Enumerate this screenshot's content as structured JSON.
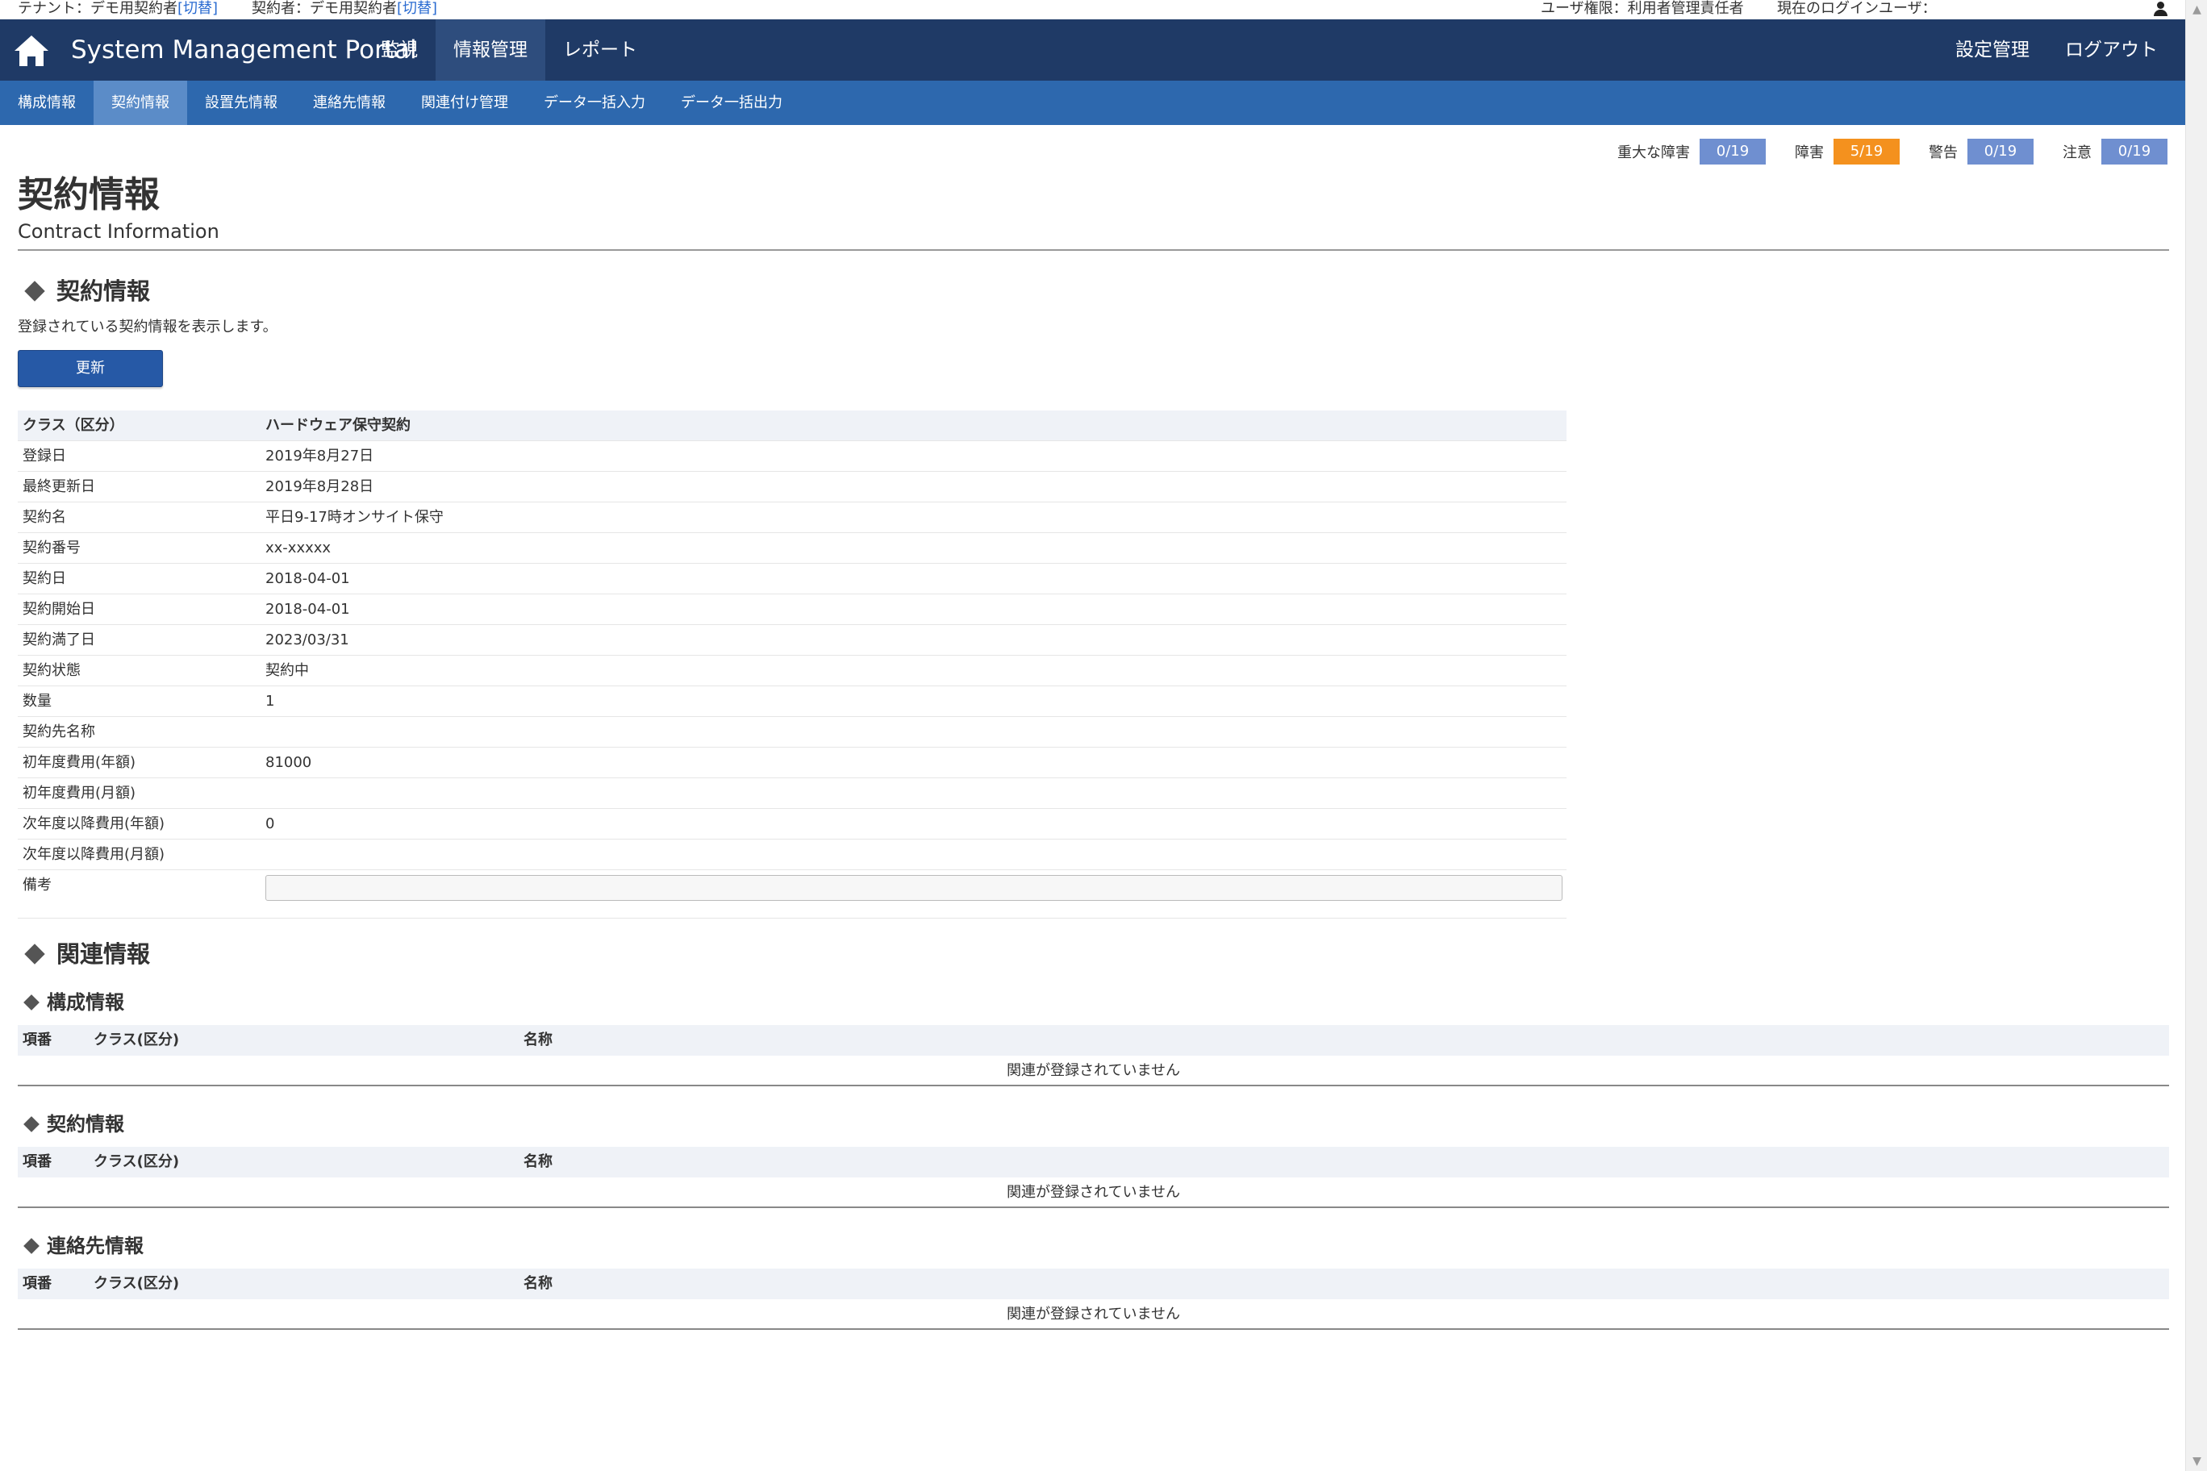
{
  "infobar": {
    "tenant_label": "テナント：デモ用契約者",
    "tenant_switch": "[切替]",
    "contractor_label": "契約者：デモ用契約者",
    "contractor_switch": "[切替]",
    "user_role": "ユーザ権限：利用者管理責任者",
    "login_user": "現在のログインユーザ："
  },
  "header": {
    "brand": "System Management Portal",
    "nav": [
      "監視",
      "情報管理",
      "レポート"
    ],
    "active_nav": "情報管理",
    "right_nav": [
      "設定管理",
      "ログアウト"
    ]
  },
  "subnav": {
    "items": [
      "構成情報",
      "契約情報",
      "設置先情報",
      "連絡先情報",
      "関連付け管理",
      "データ一括入力",
      "データ一括出力"
    ],
    "active": "契約情報"
  },
  "alerts": [
    {
      "label": "重大な障害",
      "value": "0/19",
      "color": "#6f8fd0"
    },
    {
      "label": "障害",
      "value": "5/19",
      "color": "#f4911e"
    },
    {
      "label": "警告",
      "value": "0/19",
      "color": "#6f8fd0"
    },
    {
      "label": "注意",
      "value": "0/19",
      "color": "#6f8fd0"
    }
  ],
  "page": {
    "title": "契約情報",
    "subtitle": "Contract Information"
  },
  "contract_section": {
    "heading": "契約情報",
    "description": "登録されている契約情報を表示します。",
    "update_button": "更新",
    "header_row": {
      "key": "クラス（区分）",
      "value": "ハードウェア保守契約"
    },
    "rows": [
      {
        "key": "登録日",
        "value": "2019年8月27日"
      },
      {
        "key": "最終更新日",
        "value": "2019年8月28日"
      },
      {
        "key": "契約名",
        "value": "平日9-17時オンサイト保守"
      },
      {
        "key": "契約番号",
        "value": "xx-xxxxx"
      },
      {
        "key": "契約日",
        "value": "2018-04-01"
      },
      {
        "key": "契約開始日",
        "value": "2018-04-01"
      },
      {
        "key": "契約満了日",
        "value": "2023/03/31"
      },
      {
        "key": "契約状態",
        "value": "契約中"
      },
      {
        "key": "数量",
        "value": "1"
      },
      {
        "key": "契約先名称",
        "value": ""
      },
      {
        "key": "初年度費用(年額)",
        "value": "81000"
      },
      {
        "key": "初年度費用(月額)",
        "value": ""
      },
      {
        "key": "次年度以降費用(年額)",
        "value": "0"
      },
      {
        "key": "次年度以降費用(月額)",
        "value": ""
      }
    ],
    "notes_label": "備考",
    "notes_value": ""
  },
  "related": {
    "heading": "関連情報",
    "columns": [
      "項番",
      "クラス(区分)",
      "名称"
    ],
    "tables": [
      {
        "title": "構成情報",
        "empty": "関連が登録されていません"
      },
      {
        "title": "契約情報",
        "empty": "関連が登録されていません"
      },
      {
        "title": "連絡先情報",
        "empty": "関連が登録されていません"
      }
    ]
  }
}
